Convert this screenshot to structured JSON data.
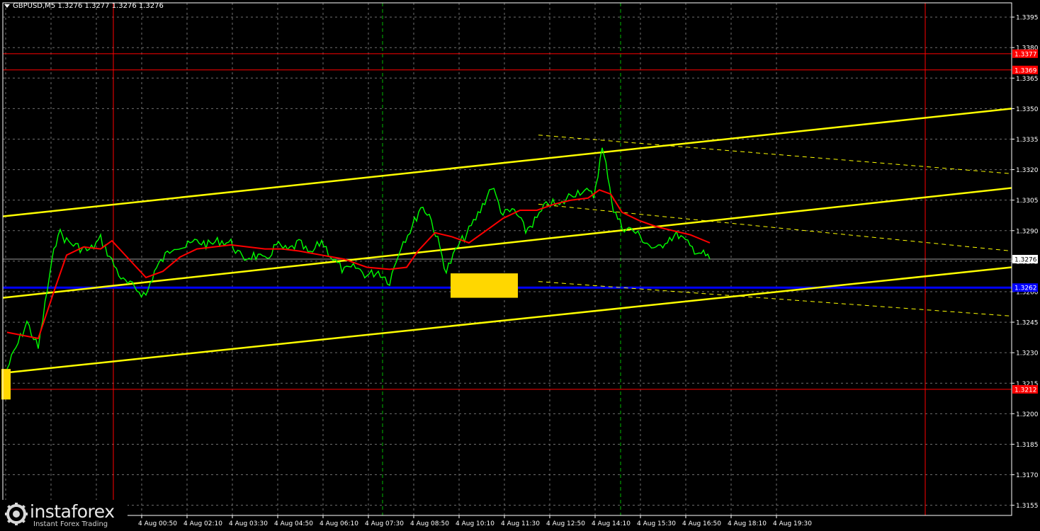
{
  "header": {
    "symbol_line": "GBPUSD,M5  1.3276 1.3277 1.3276 1.3276"
  },
  "logo": {
    "name": "instaforex",
    "tagline": "Instant Forex Trading",
    "icon": "gear-globe-icon"
  },
  "colors": {
    "background": "#000000",
    "grid": "#6f6f6f",
    "axis": "#ffffff",
    "candles": "#00ff00",
    "moving_average": "#ff0000",
    "channel": "#ffff00",
    "support_blue": "#0000ff",
    "level_red": "#ff0000",
    "session_line_green": "#00b800",
    "signal_box": "#ffd700"
  },
  "chart_data": {
    "type": "line",
    "title": "GBPUSD,M5",
    "ohlc_last": {
      "open": 1.3276,
      "high": 1.3277,
      "low": 1.3276,
      "close": 1.3276
    },
    "y_ticks": [
      1.3155,
      1.317,
      1.3185,
      1.32,
      1.3215,
      1.323,
      1.3245,
      1.326,
      1.3275,
      1.329,
      1.3305,
      1.332,
      1.3335,
      1.335,
      1.3365,
      1.338,
      1.3395
    ],
    "ylim": [
      1.315,
      1.3402
    ],
    "x_ticks": [
      "4 Aug 00:50",
      "4 Aug 02:10",
      "4 Aug 03:30",
      "4 Aug 04:50",
      "4 Aug 06:10",
      "4 Aug 07:30",
      "4 Aug 08:50",
      "4 Aug 10:10",
      "4 Aug 11:30",
      "4 Aug 12:50",
      "4 Aug 14:10",
      "4 Aug 15:30",
      "4 Aug 16:50",
      "4 Aug 18:10",
      "4 Aug 19:30"
    ],
    "series": [
      {
        "name": "",
        "kind": "price",
        "x": [
          "23:25",
          "00:00",
          "00:20",
          "00:40",
          "00:55",
          "01:10",
          "01:30",
          "01:50",
          "02:10",
          "02:30",
          "02:50",
          "03:10",
          "03:30",
          "03:45",
          "04:00",
          "04:20",
          "04:40",
          "05:00",
          "05:20",
          "05:40",
          "06:00",
          "06:20",
          "06:40",
          "07:00",
          "07:20",
          "07:40",
          "08:00",
          "08:20",
          "08:40",
          "09:00",
          "09:20",
          "09:40",
          "10:00",
          "10:20",
          "10:40",
          "11:00",
          "11:20",
          "11:35",
          "11:50",
          "12:05",
          "12:20",
          "12:40",
          "13:00",
          "13:20",
          "13:40",
          "14:00",
          "14:20",
          "14:40",
          "15:00",
          "15:20",
          "15:40",
          "16:00",
          "16:20",
          "16:40",
          "16:55",
          "17:05",
          "17:15",
          "17:30",
          "17:50",
          "18:10",
          "18:30",
          "18:50",
          "19:10",
          "19:30",
          "19:50",
          "20:05"
        ],
        "values": [
          1.3222,
          1.3245,
          1.3232,
          1.3268,
          1.329,
          1.3285,
          1.3282,
          1.328,
          1.3286,
          1.3275,
          1.3265,
          1.3262,
          1.3258,
          1.327,
          1.3276,
          1.3283,
          1.3282,
          1.3285,
          1.3283,
          1.3285,
          1.3284,
          1.3276,
          1.3278,
          1.3275,
          1.3283,
          1.328,
          1.3284,
          1.3278,
          1.3285,
          1.3276,
          1.327,
          1.3272,
          1.3268,
          1.327,
          1.3265,
          1.3283,
          1.3292,
          1.3302,
          1.3298,
          1.3285,
          1.327,
          1.3282,
          1.329,
          1.33,
          1.3312,
          1.3298,
          1.33,
          1.329,
          1.3296,
          1.3304,
          1.3302,
          1.3308,
          1.331,
          1.3307,
          1.333,
          1.3318,
          1.33,
          1.3292,
          1.329,
          1.3285,
          1.328,
          1.3286,
          1.3288,
          1.3282,
          1.3279,
          1.3276
        ]
      },
      {
        "name": "",
        "kind": "moving_average",
        "x": [
          "23:25",
          "00:20",
          "00:50",
          "01:10",
          "01:40",
          "02:10",
          "02:30",
          "03:00",
          "03:30",
          "04:00",
          "04:30",
          "05:00",
          "05:30",
          "06:00",
          "06:30",
          "07:00",
          "07:30",
          "08:00",
          "08:40",
          "09:20",
          "10:00",
          "10:40",
          "11:10",
          "11:30",
          "12:00",
          "12:30",
          "13:00",
          "13:30",
          "14:00",
          "14:30",
          "15:00",
          "15:30",
          "16:00",
          "16:30",
          "16:50",
          "17:10",
          "17:30",
          "18:00",
          "18:30",
          "19:00",
          "19:30",
          "20:05"
        ],
        "values": [
          1.324,
          1.3237,
          1.3262,
          1.3278,
          1.3282,
          1.3281,
          1.3285,
          1.3276,
          1.3267,
          1.327,
          1.3277,
          1.3281,
          1.3282,
          1.3283,
          1.3282,
          1.3281,
          1.3281,
          1.328,
          1.3278,
          1.3276,
          1.3272,
          1.3271,
          1.3272,
          1.328,
          1.3289,
          1.3287,
          1.3284,
          1.329,
          1.3296,
          1.33,
          1.33,
          1.3303,
          1.3305,
          1.3306,
          1.331,
          1.3308,
          1.3299,
          1.3295,
          1.3292,
          1.329,
          1.3288,
          1.3284
        ]
      }
    ],
    "levels": [
      {
        "price": 1.3377,
        "label": "1.3377",
        "color": "#ff0000"
      },
      {
        "price": 1.3369,
        "label": "1.3369",
        "color": "#ff0000"
      },
      {
        "price": 1.3262,
        "label": "1.3262",
        "color": "#0000ff"
      },
      {
        "price": 1.3212,
        "label": "1.3212",
        "color": "#ff0000"
      }
    ],
    "current_price": {
      "price": 1.3276,
      "label": "1.3276"
    },
    "trend_lines": [
      {
        "from": [
          "23:25",
          1.3297
        ],
        "to": [
          "23:25+",
          1.335
        ]
      },
      {
        "from": [
          "23:25",
          1.3257
        ],
        "to": [
          "23:25+",
          1.3311
        ]
      },
      {
        "from": [
          "23:25",
          1.322
        ],
        "to": [
          "23:25+",
          1.3272
        ]
      }
    ],
    "vertical_lines_red": [
      "01:10",
      "22:00"
    ],
    "vertical_lines_green": [
      "07:30",
      "14:10"
    ],
    "signal_boxes": [
      {
        "x_from": "23:25",
        "x_to": "23:30",
        "y_low": 1.3207,
        "y_high": 1.322
      },
      {
        "x_from": "09:45",
        "x_to": "11:20",
        "y_low": 1.3257,
        "y_high": 1.3269
      }
    ]
  }
}
